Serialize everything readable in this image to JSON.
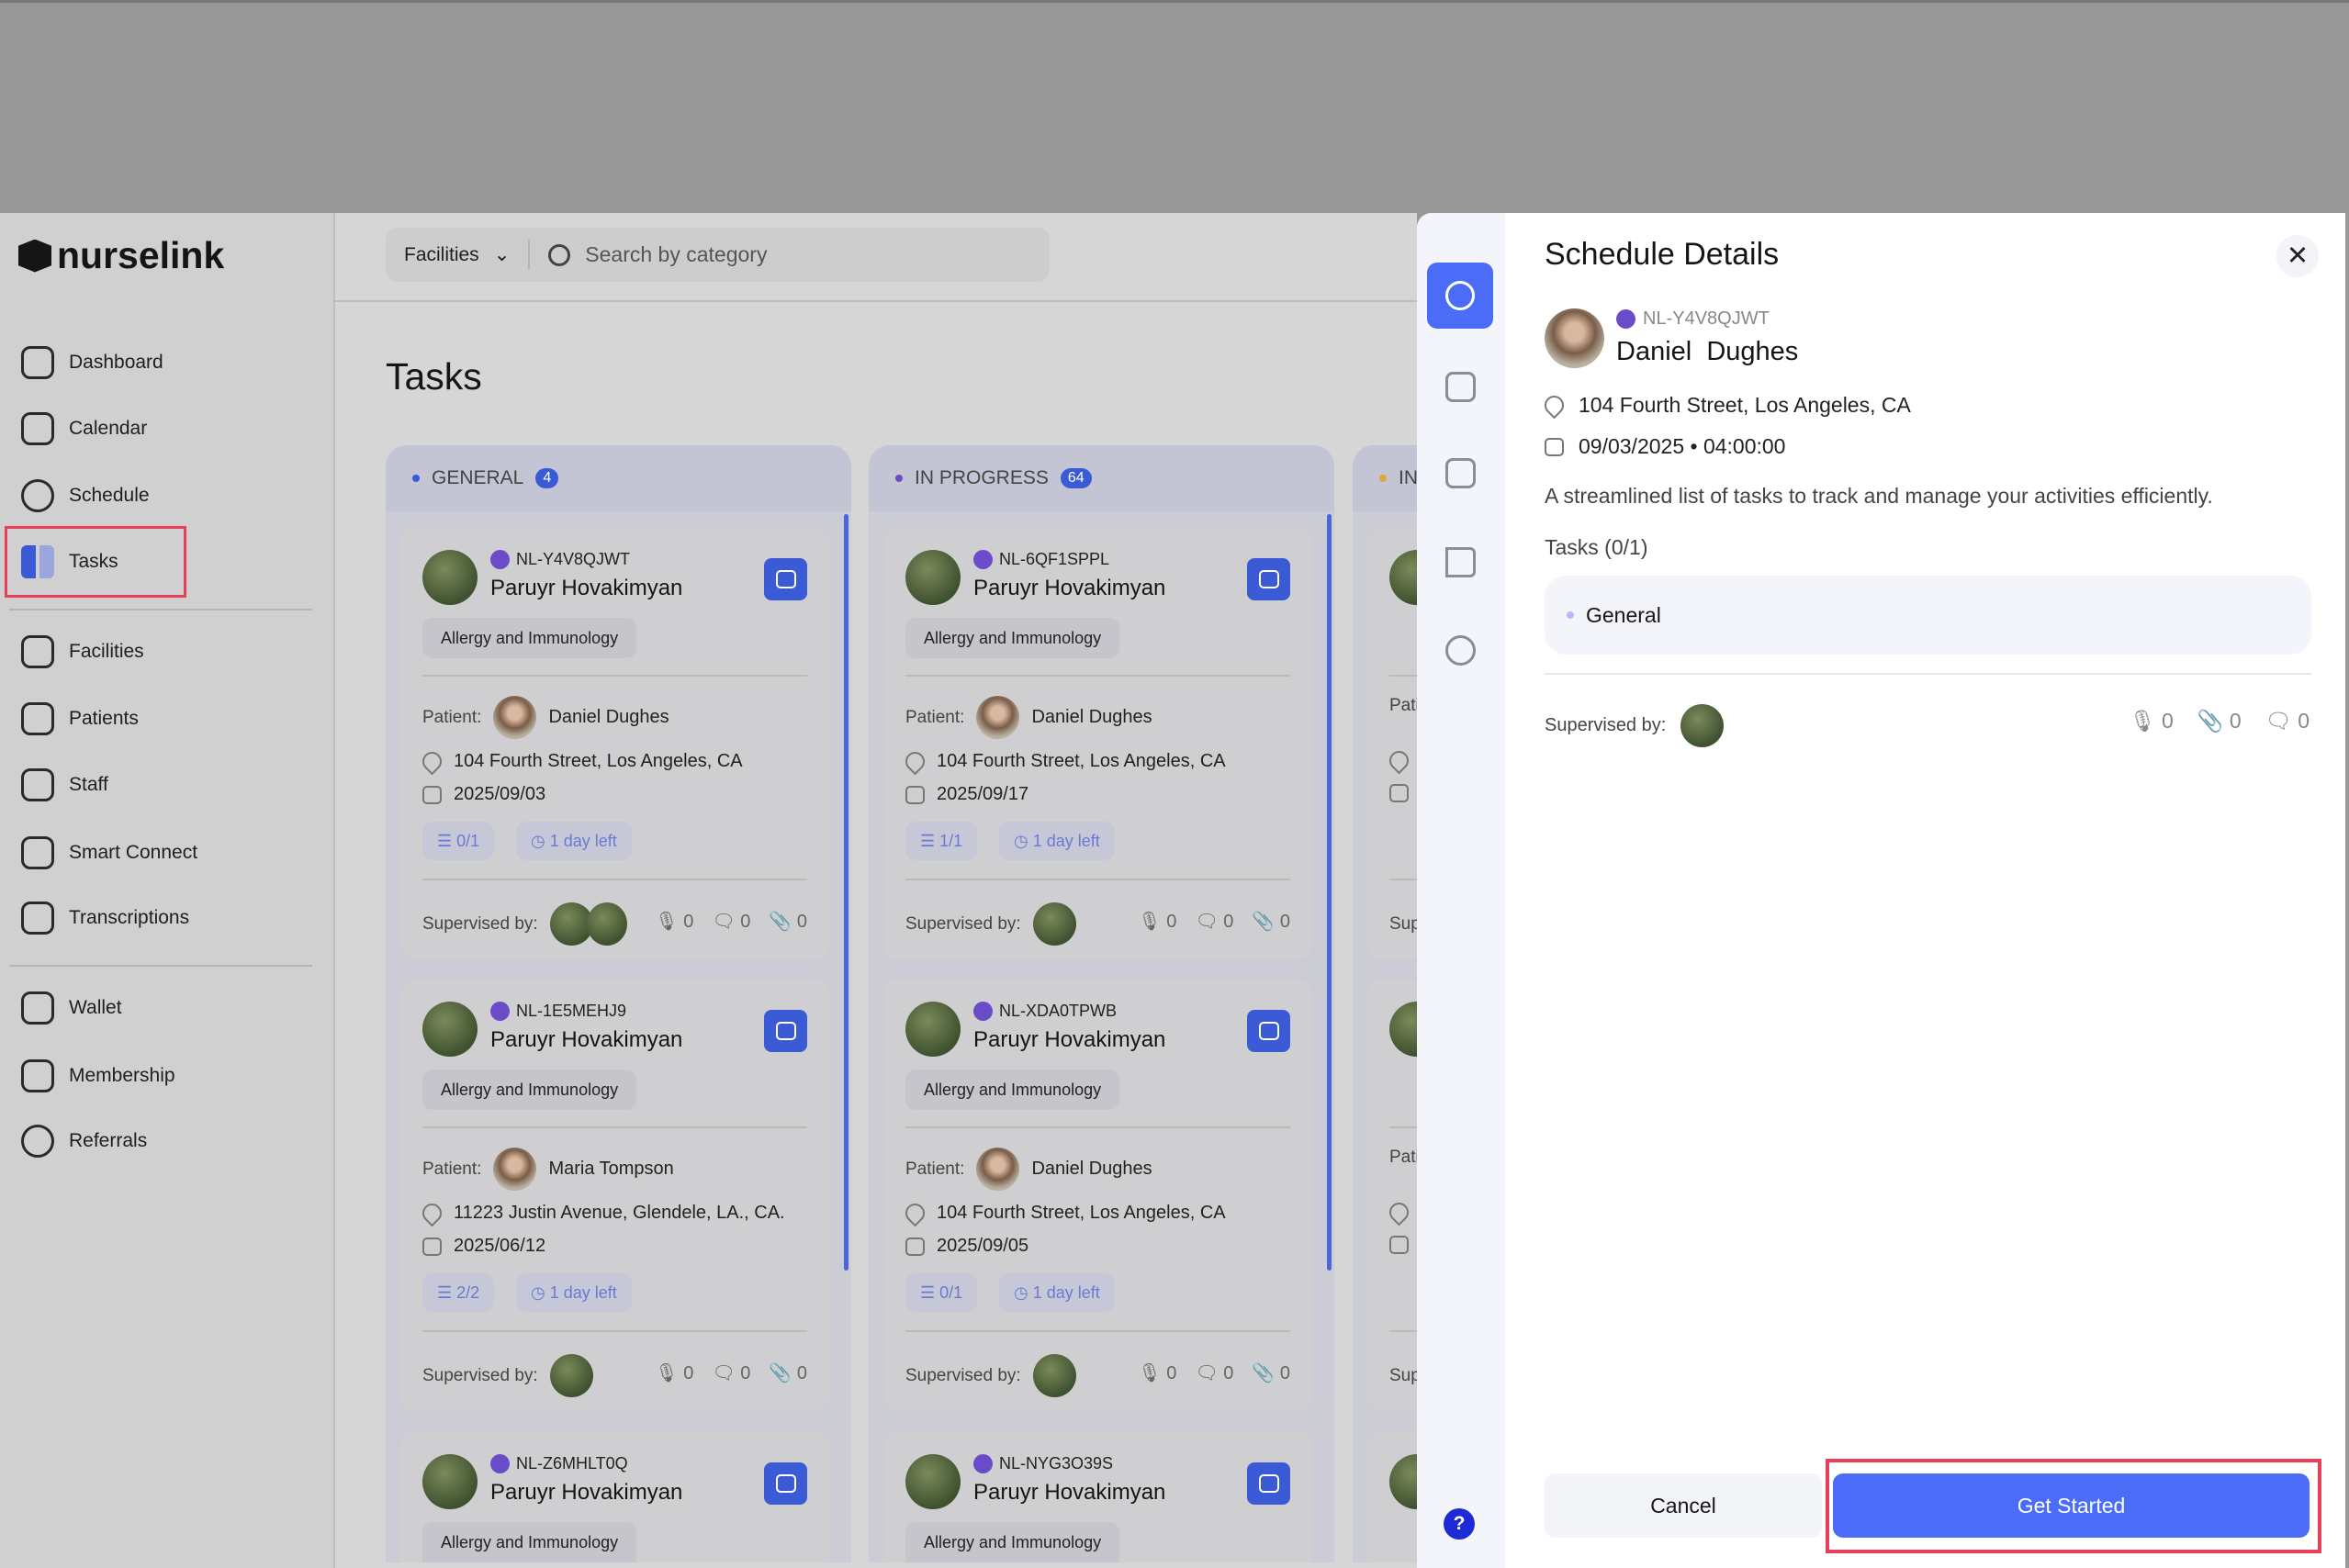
{
  "brand": {
    "name": "nurselink"
  },
  "sidebar": {
    "items": [
      {
        "label": "Dashboard",
        "icon": "grid-icon"
      },
      {
        "label": "Calendar",
        "icon": "calendar-icon"
      },
      {
        "label": "Schedule",
        "icon": "clock-icon"
      },
      {
        "label": "Tasks",
        "icon": "tasks-icon"
      },
      {
        "label": "Facilities",
        "icon": "building-icon"
      },
      {
        "label": "Patients",
        "icon": "users-icon"
      },
      {
        "label": "Staff",
        "icon": "badge-icon"
      },
      {
        "label": "Smart Connect",
        "icon": "chat-icon"
      },
      {
        "label": "Transcriptions",
        "icon": "mic-icon"
      },
      {
        "label": "Wallet",
        "icon": "wallet-icon"
      },
      {
        "label": "Membership",
        "icon": "diamond-icon"
      },
      {
        "label": "Referrals",
        "icon": "referral-icon"
      }
    ]
  },
  "header": {
    "filter": "Facilities",
    "search_placeholder": "Search by category"
  },
  "page": {
    "title": "Tasks"
  },
  "labels": {
    "patient": "Patient:",
    "supervised": "Supervised by:"
  },
  "columns": [
    {
      "title": "GENERAL",
      "count": "4",
      "cards": [
        {
          "id": "NL-Y4V8QJWT",
          "name": "Paruyr Hovakimyan",
          "tag": "Allergy and Immunology",
          "patient": "Daniel Dughes",
          "address": "104 Fourth Street, Los Angeles, CA",
          "date": "2025/09/03",
          "progress": "0/1",
          "due": "1 day left",
          "mic": "0",
          "comments": "0",
          "attach": "0"
        },
        {
          "id": "NL-1E5MEHJ9",
          "name": "Paruyr Hovakimyan",
          "tag": "Allergy and Immunology",
          "patient": "Maria Tompson",
          "address": "11223 Justin Avenue, Glendele, LA., CA.",
          "date": "2025/06/12",
          "progress": "2/2",
          "due": "1 day left",
          "mic": "0",
          "comments": "0",
          "attach": "0"
        },
        {
          "id": "NL-Z6MHLT0Q",
          "name": "Paruyr Hovakimyan",
          "tag": "Allergy and Immunology"
        }
      ]
    },
    {
      "title": "IN PROGRESS",
      "count": "64",
      "cards": [
        {
          "id": "NL-6QF1SPPL",
          "name": "Paruyr Hovakimyan",
          "tag": "Allergy and Immunology",
          "patient": "Daniel Dughes",
          "address": "104 Fourth Street, Los Angeles, CA",
          "date": "2025/09/17",
          "progress": "1/1",
          "due": "1 day left",
          "mic": "0",
          "comments": "0",
          "attach": "0"
        },
        {
          "id": "NL-XDA0TPWB",
          "name": "Paruyr Hovakimyan",
          "tag": "Allergy and Immunology",
          "patient": "Daniel Dughes",
          "address": "104 Fourth Street, Los Angeles, CA",
          "date": "2025/09/05",
          "progress": "0/1",
          "due": "1 day left",
          "mic": "0",
          "comments": "0",
          "attach": "0"
        },
        {
          "id": "NL-NYG3O39S",
          "name": "Paruyr Hovakimyan",
          "tag": "Allergy and Immunology"
        }
      ]
    },
    {
      "title": "IN"
    }
  ],
  "drawer": {
    "title": "Schedule Details",
    "id": "NL-Y4V8QJWT",
    "name": "Daniel  Dughes",
    "address": "104 Fourth Street, Los Angeles, CA",
    "datetime": "09/03/2025 • 04:00:00",
    "description": "A streamlined list of tasks to track and manage your activities efficiently.",
    "tasks_label": "Tasks (0/1)",
    "task_item": "General",
    "supervised": "Supervised by:",
    "mic": "0",
    "attach": "0",
    "comments": "0",
    "cancel": "Cancel",
    "start": "Get Started",
    "close": "✕",
    "help": "?"
  },
  "colors": {
    "accent": "#4a6cf7",
    "highlight": "#e8405a"
  }
}
